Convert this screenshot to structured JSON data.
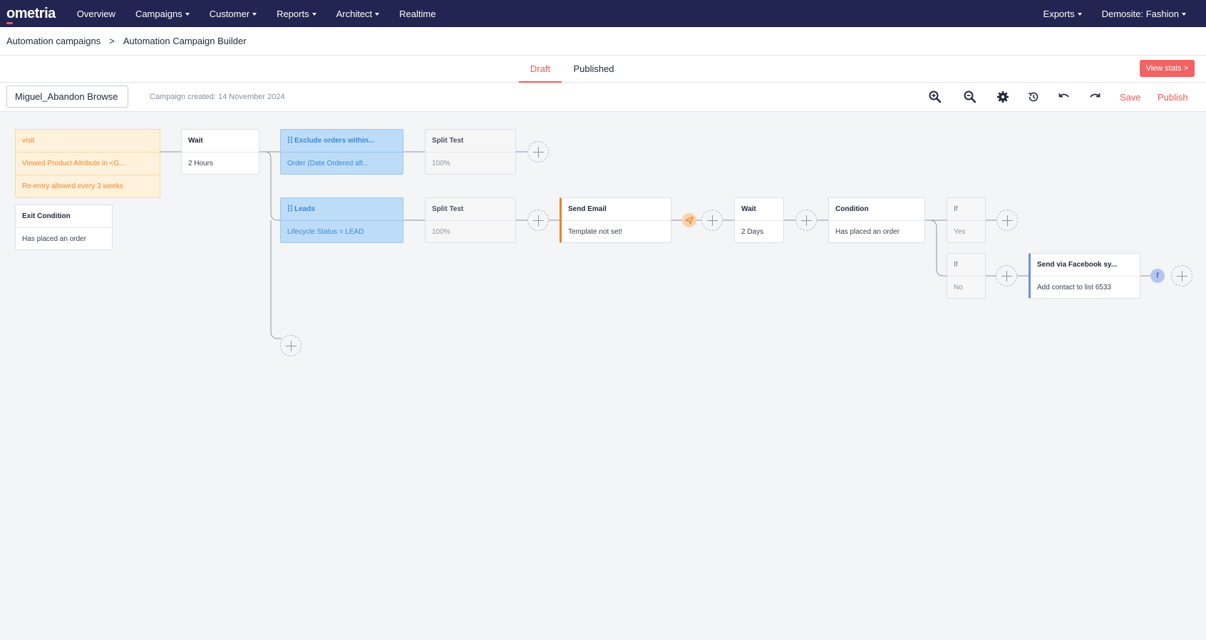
{
  "nav": {
    "logo": "ometria",
    "items": [
      {
        "label": "Overview",
        "dropdown": false
      },
      {
        "label": "Campaigns",
        "dropdown": true
      },
      {
        "label": "Customer",
        "dropdown": true
      },
      {
        "label": "Reports",
        "dropdown": true
      },
      {
        "label": "Architect",
        "dropdown": true
      },
      {
        "label": "Realtime",
        "dropdown": false
      }
    ],
    "right": [
      {
        "label": "Exports",
        "dropdown": true
      },
      {
        "label": "Demosite: Fashion",
        "dropdown": true
      }
    ]
  },
  "breadcrumb": {
    "parent": "Automation campaigns",
    "separator": ">",
    "current": "Automation Campaign Builder"
  },
  "tabs": {
    "draft": "Draft",
    "published": "Published",
    "view_stats": "View stats >"
  },
  "toolbar": {
    "campaign_name": "Miguel_Abandon Browse",
    "created": "Campaign created: 14 November 2024",
    "save": "Save",
    "publish": "Publish"
  },
  "colors": {
    "nav_bg": "#222451",
    "accent": "#f05a5a",
    "trigger": "#fff1dc",
    "filter": "#bcdcf8",
    "email_accent": "#f27f2c",
    "facebook_accent": "#6f8fdc"
  },
  "flow": {
    "trigger": {
      "title": "visit",
      "condition": "Viewed Product Attribute in <G...",
      "reentry": "Re-entry allowed every 3 weeks"
    },
    "exit_condition": {
      "title": "Exit Condition",
      "body": "Has placed an order"
    },
    "wait_1": {
      "title": "Wait",
      "body": "2 Hours"
    },
    "filter_exclude": {
      "title": "Exclude orders within...",
      "body": "Order (Date Ordered aft..."
    },
    "split_1": {
      "title": "Split Test",
      "body": "100%"
    },
    "filter_leads": {
      "title": "Leads",
      "body": "Lifecycle Status = LEAD"
    },
    "split_2": {
      "title": "Split Test",
      "body": "100%"
    },
    "send_email": {
      "title": "Send Email",
      "body": "Template not set!"
    },
    "wait_2": {
      "title": "Wait",
      "body": "2 Days"
    },
    "condition": {
      "title": "Condition",
      "body": "Has placed an order"
    },
    "if_yes": {
      "title": "If",
      "body": "Yes"
    },
    "if_no": {
      "title": "If",
      "body": "No"
    },
    "send_facebook": {
      "title": "Send via Facebook sy...",
      "body": "Add contact to list 6533"
    },
    "facebook_badge": "f"
  }
}
